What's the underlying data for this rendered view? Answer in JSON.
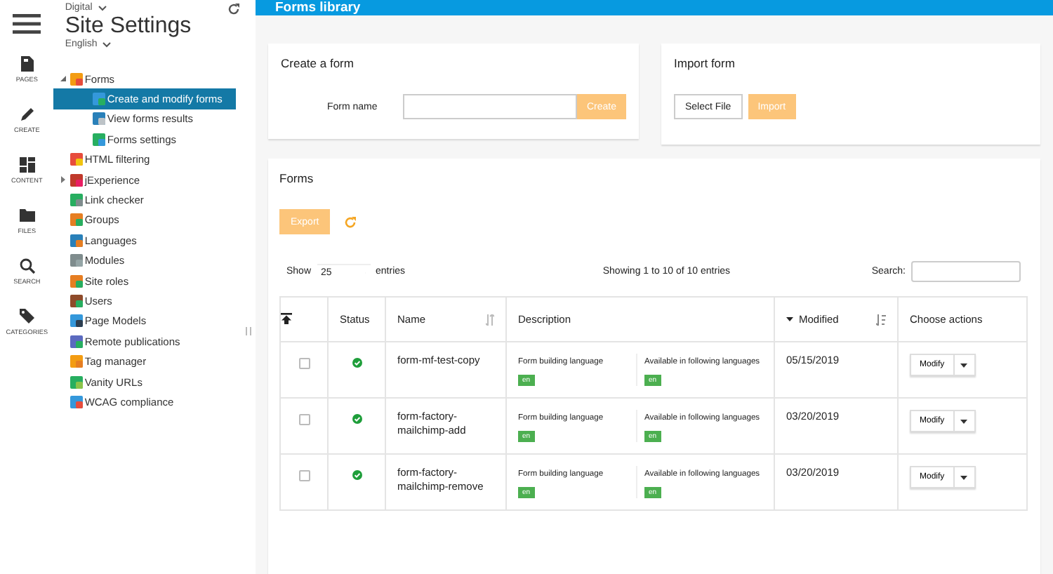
{
  "rail": {
    "items": [
      {
        "label": "PAGES"
      },
      {
        "label": "CREATE"
      },
      {
        "label": "CONTENT"
      },
      {
        "label": "FILES"
      },
      {
        "label": "SEARCH"
      },
      {
        "label": "CATEGORIES"
      }
    ]
  },
  "sidebar": {
    "site": "Digital",
    "title": "Site Settings",
    "language": "English",
    "tree": [
      {
        "label": "Forms",
        "selected": false,
        "expanded": true,
        "children": [
          {
            "label": "Create and modify forms",
            "selected": true
          },
          {
            "label": "View forms results",
            "selected": false
          },
          {
            "label": "Forms settings",
            "selected": false
          }
        ]
      },
      {
        "label": "HTML filtering",
        "selected": false
      },
      {
        "label": "jExperience",
        "selected": false,
        "expanded": false
      },
      {
        "label": "Link checker",
        "selected": false
      },
      {
        "label": "Groups",
        "selected": false
      },
      {
        "label": "Languages",
        "selected": false
      },
      {
        "label": "Modules",
        "selected": false
      },
      {
        "label": "Site roles",
        "selected": false
      },
      {
        "label": "Users",
        "selected": false
      },
      {
        "label": "Page Models",
        "selected": false
      },
      {
        "label": "Remote publications",
        "selected": false
      },
      {
        "label": "Tag manager",
        "selected": false
      },
      {
        "label": "Vanity URLs",
        "selected": false
      },
      {
        "label": "WCAG compliance",
        "selected": false
      }
    ]
  },
  "header": {
    "title": "Forms library"
  },
  "create_card": {
    "title": "Create a form",
    "field_label": "Form name",
    "button": "Create"
  },
  "import_card": {
    "title": "Import form",
    "select_button": "Select File",
    "import_button": "Import"
  },
  "forms": {
    "title": "Forms",
    "export_button": "Export",
    "show_label": "Show",
    "page_size": "25",
    "entries_label": "entries",
    "info": "Showing 1 to 10 of 10 entries",
    "search_label": "Search:",
    "columns": [
      "Status",
      "Name",
      "Description",
      "Modified",
      "Choose actions"
    ],
    "rows": [
      {
        "checked": false,
        "published": true,
        "name": "form-mf-test-copy",
        "building_label": "Form building language",
        "building_lang": "en",
        "available_label": "Available in following languages",
        "available_lang": "en",
        "modified": "05/15/2019",
        "action": "Modify"
      },
      {
        "checked": false,
        "published": true,
        "name": "form-factory-mailchimp-add",
        "building_label": "Form building language",
        "building_lang": "en",
        "available_label": "Available in following languages",
        "available_lang": "en",
        "modified": "03/20/2019",
        "action": "Modify"
      },
      {
        "checked": false,
        "published": true,
        "name": "form-factory-mailchimp-remove",
        "building_label": "Form building language",
        "building_lang": "en",
        "available_label": "Available in following languages",
        "available_lang": "en",
        "modified": "03/20/2019",
        "action": "Modify"
      }
    ]
  }
}
